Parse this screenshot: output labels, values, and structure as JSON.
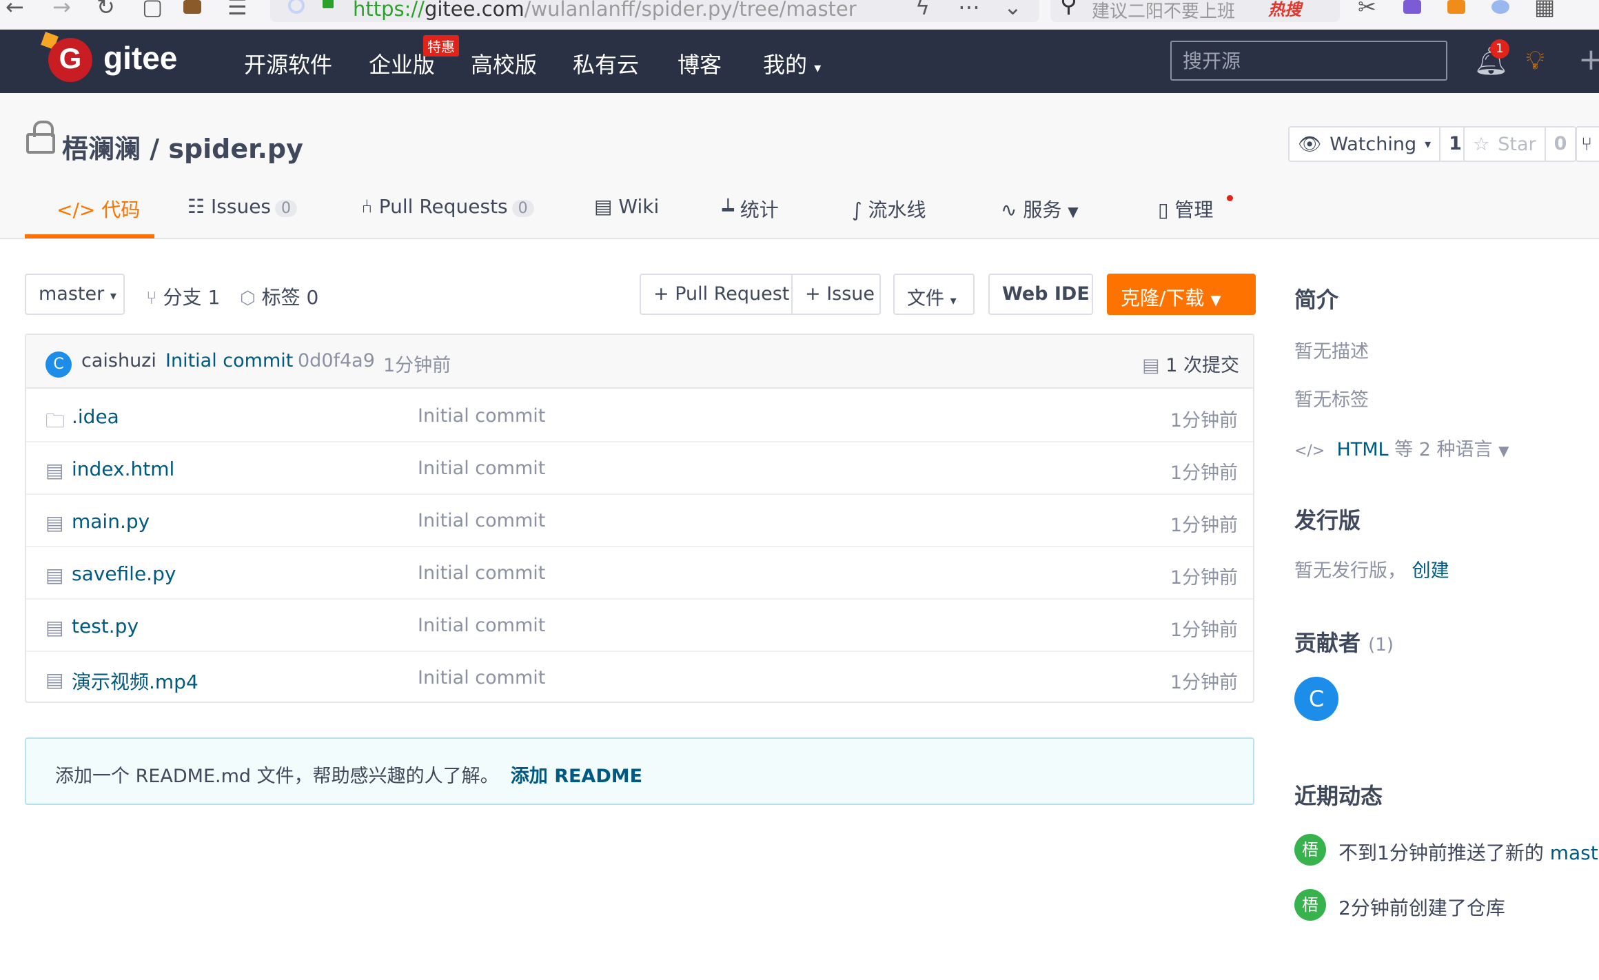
{
  "browser": {
    "url_proto": "https://",
    "url_host": "gitee.com",
    "url_path": "/wulanlanff/spider.py/tree/master",
    "search_placeholder": "建议二阳不要上班",
    "search_hot": "热搜"
  },
  "header": {
    "logo_text": "gitee",
    "nav": [
      "开源软件",
      "企业版",
      "高校版",
      "私有云",
      "博客",
      "我的"
    ],
    "enterprise_badge": "特惠",
    "search_placeholder": "搜开源",
    "notification_count": "1"
  },
  "repo": {
    "title": "梧澜澜 / spider.py",
    "watch_label": "Watching",
    "watch_count": "1",
    "star_label": "Star",
    "star_count": "0"
  },
  "tabs": [
    {
      "label": "代码",
      "icon": "code-icon",
      "active": true
    },
    {
      "label": "Issues",
      "count": "0",
      "icon": "issues-icon"
    },
    {
      "label": "Pull Requests",
      "count": "0",
      "icon": "pull-request-icon"
    },
    {
      "label": "Wiki",
      "icon": "wiki-icon"
    },
    {
      "label": "统计",
      "icon": "stats-icon"
    },
    {
      "label": "流水线",
      "icon": "pipeline-icon"
    },
    {
      "label": "服务",
      "icon": "service-icon"
    },
    {
      "label": "管理",
      "icon": "manage-icon"
    }
  ],
  "toolbar": {
    "branch": "master",
    "branches_label": "分支",
    "branches_count": "1",
    "tags_label": "标签",
    "tags_count": "0",
    "pull_request": "+ Pull Request",
    "issue": "+ Issue",
    "file": "文件",
    "web_ide": "Web IDE",
    "clone": "克隆/下载"
  },
  "commit": {
    "avatar_letter": "C",
    "author": "caishuzi",
    "message": "Initial commit",
    "hash": "0d0f4a9",
    "time": "1分钟前",
    "count_label": "1 次提交"
  },
  "files": [
    {
      "name": ".idea",
      "type": "folder",
      "message": "Initial commit",
      "time": "1分钟前"
    },
    {
      "name": "index.html",
      "type": "file",
      "message": "Initial commit",
      "time": "1分钟前"
    },
    {
      "name": "main.py",
      "type": "file",
      "message": "Initial commit",
      "time": "1分钟前"
    },
    {
      "name": "savefile.py",
      "type": "file",
      "message": "Initial commit",
      "time": "1分钟前"
    },
    {
      "name": "test.py",
      "type": "file",
      "message": "Initial commit",
      "time": "1分钟前"
    },
    {
      "name": "演示视频.mp4",
      "type": "file",
      "message": "Initial commit",
      "time": "1分钟前"
    }
  ],
  "readme": {
    "message": "添加一个 README.md 文件，帮助感兴趣的人了解。",
    "link": "添加 README"
  },
  "sidebar": {
    "intro_title": "简介",
    "no_desc": "暂无描述",
    "no_tags": "暂无标签",
    "lang_html": "HTML",
    "lang_rest": "等 2 种语言",
    "release_title": "发行版",
    "no_release": "暂无发行版，",
    "create": "创建",
    "contrib_title": "贡献者",
    "contrib_count": "(1)",
    "contrib_letter": "C",
    "activity_title": "近期动态",
    "activities": [
      {
        "avatar": "梧",
        "text": "不到1分钟前推送了新的",
        "link": "maste"
      },
      {
        "avatar": "梧",
        "text": "2分钟前创建了仓库",
        "link": ""
      }
    ]
  },
  "colors": {
    "nav_bg": "#2a3145",
    "accent": "#fe7300",
    "link": "#005980"
  }
}
